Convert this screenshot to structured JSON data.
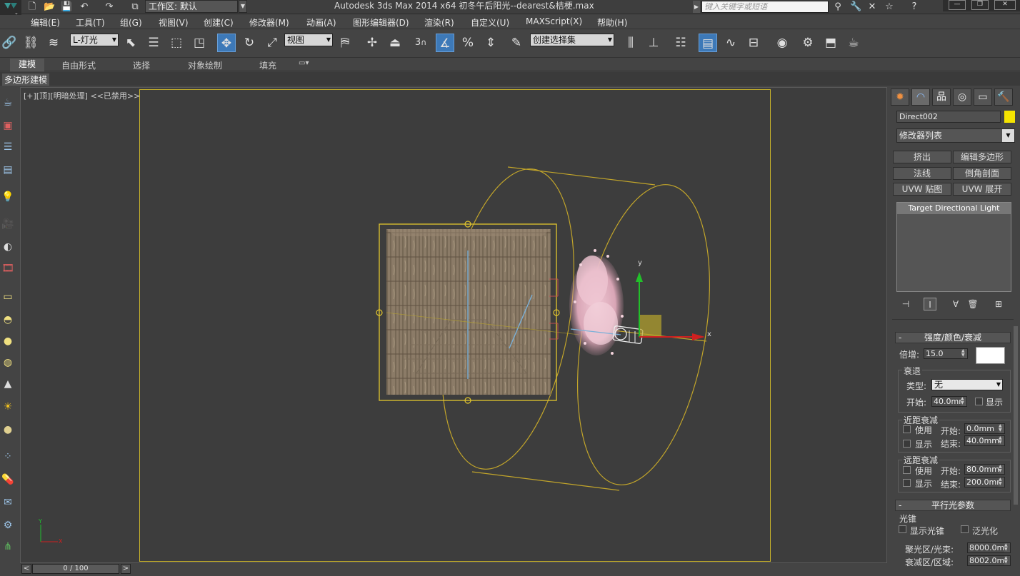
{
  "titlebar": {
    "workspace": "工作区: 默认",
    "app_title": "Autodesk 3ds Max  2014 x64      初冬午后阳光--dearest&桔梗.max",
    "search_placeholder": "键入关键字或短语"
  },
  "menu": [
    "编辑(E)",
    "工具(T)",
    "组(G)",
    "视图(V)",
    "创建(C)",
    "修改器(M)",
    "动画(A)",
    "图形编辑器(D)",
    "渲染(R)",
    "自定义(U)",
    "MAXScript(X)",
    "帮助(H)"
  ],
  "toolbar": {
    "selection_filter": "L-灯光",
    "ref_coord": "视图",
    "named_selection": "创建选择集",
    "snap_label": "3"
  },
  "ribbon": {
    "tabs": [
      "建模",
      "自由形式",
      "选择",
      "对象绘制",
      "填充"
    ],
    "sub": "多边形建模"
  },
  "viewport": {
    "label": "[+][顶][明暗处理]  <<已禁用>>",
    "gizmo_x": "x",
    "gizmo_y": "y",
    "axis_y": "Y",
    "axis_x": "X"
  },
  "timeline": {
    "frame": "0 / 100",
    "prev": "<",
    "next": ">"
  },
  "panel": {
    "object_name": "Direct002",
    "object_color": "#f5e400",
    "modifier_list": "修改器列表",
    "buttons": [
      "挤出",
      "编辑多边形",
      "法线",
      "倒角剖面",
      "UVW 贴图",
      "UVW 展开"
    ],
    "stack_item": "Target Directional Light",
    "intensity": {
      "header": "强度/颜色/衰减",
      "multiplier_label": "倍增:",
      "multiplier": "15.0",
      "decay_label": "衰退",
      "type_label": "类型:",
      "type_value": "无",
      "start_label": "开始:",
      "start_value": "40.0mm",
      "show_label": "显示"
    },
    "near_atten": {
      "label": "近距衰减",
      "use": "使用",
      "show": "显示",
      "start_label": "开始:",
      "start": "0.0mm",
      "end_label": "结束:",
      "end": "40.0mm"
    },
    "far_atten": {
      "label": "远距衰减",
      "use": "使用",
      "show": "显示",
      "start_label": "开始:",
      "start": "80.0mm",
      "end_label": "结束:",
      "end": "200.0mm"
    },
    "directional": {
      "header": "平行光参数",
      "cone_label": "光锥",
      "show_cone": "显示光锥",
      "overshoot": "泛光化",
      "hotspot_label": "聚光区/光束:",
      "hotspot": "8000.0mm",
      "falloff_label": "衰减区/区域:",
      "falloff": "8002.0mm"
    }
  }
}
